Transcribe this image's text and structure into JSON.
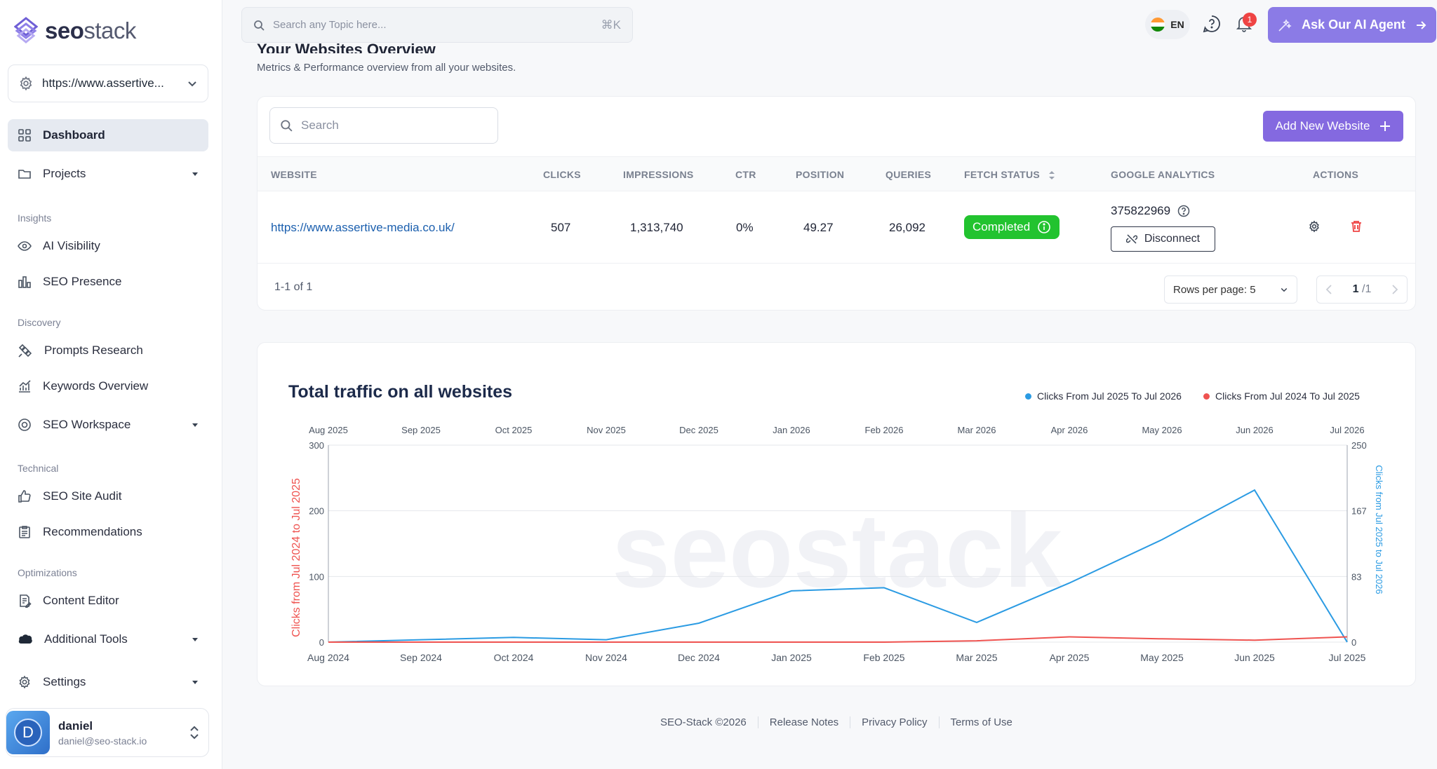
{
  "brand": {
    "name_bold": "seo",
    "name_light": "stack"
  },
  "site_selector": {
    "value": "https://www.assertive..."
  },
  "sidebar": {
    "dashboard": "Dashboard",
    "projects": "Projects",
    "section_insights": "Insights",
    "ai_visibility": "AI Visibility",
    "seo_presence": "SEO Presence",
    "section_discovery": "Discovery",
    "prompts_research": "Prompts Research",
    "keywords_overview": "Keywords Overview",
    "seo_workspace": "SEO Workspace",
    "section_technical": "Technical",
    "seo_site_audit": "SEO Site Audit",
    "recommendations": "Recommendations",
    "section_optimizations": "Optimizations",
    "content_editor": "Content Editor",
    "additional_tools": "Additional Tools",
    "settings": "Settings"
  },
  "user": {
    "initial": "D",
    "name": "daniel",
    "email": "daniel@seo-stack.io"
  },
  "topbar": {
    "search_placeholder": "Search any Topic here...",
    "shortcut": "⌘K",
    "language": "EN",
    "notifications_count": "1",
    "ai_button": "Ask Our AI Agent"
  },
  "overview": {
    "title": "Your Websites Overview",
    "subtitle": "Metrics & Performance overview from all your websites."
  },
  "table": {
    "search_placeholder": "Search",
    "add_button": "Add New Website",
    "headers": {
      "website": "WEBSITE",
      "clicks": "CLICKS",
      "impressions": "IMPRESSIONS",
      "ctr": "CTR",
      "position": "POSITION",
      "queries": "QUERIES",
      "fetch_status": "FETCH STATUS",
      "google_analytics": "GOOGLE ANALYTICS",
      "actions": "ACTIONS"
    },
    "row": {
      "website": "https://www.assertive-media.co.uk/",
      "clicks": "507",
      "impressions": "1,313,740",
      "ctr": "0%",
      "position": "49.27",
      "queries": "26,092",
      "status": "Completed",
      "ga_id": "375822969",
      "disconnect": "Disconnect"
    },
    "count_text": "1-1 of 1",
    "rows_per_page": "Rows per page: 5",
    "page_current": "1",
    "page_total": "/1"
  },
  "colors": {
    "current": "#2b9be3",
    "previous": "#ef5350",
    "accent": "#8469e0",
    "status": "#22c32f"
  },
  "chart_data": {
    "type": "line",
    "title": "Total traffic on all websites",
    "top_x_labels": [
      "Aug 2025",
      "Sep 2025",
      "Oct 2025",
      "Nov 2025",
      "Dec 2025",
      "Jan 2026",
      "Feb 2026",
      "Mar 2026",
      "Apr 2026",
      "May 2026",
      "Jun 2026",
      "Jul 2026"
    ],
    "bottom_x_labels": [
      "Aug 2024",
      "Sep 2024",
      "Oct 2024",
      "Nov 2024",
      "Dec 2024",
      "Jan 2025",
      "Feb 2025",
      "Mar 2025",
      "Apr 2025",
      "May 2025",
      "Jun 2025",
      "Jul 2025"
    ],
    "left_ylabel": "Clicks from Jul 2024 to Jul 2025",
    "right_ylabel": "Clicks from Jul 2025 to Jul 2026",
    "left_ylim": [
      0,
      300
    ],
    "left_ticks": [
      "300",
      "200",
      "100",
      "0"
    ],
    "right_ylim": [
      0,
      250
    ],
    "right_ticks": [
      "250",
      "167",
      "83",
      "0"
    ],
    "series": [
      {
        "name": "Clicks From Jul 2025 To Jul 2026",
        "axis": "right",
        "values": [
          0,
          3,
          6,
          3,
          24,
          65,
          69,
          25,
          75,
          130,
          193,
          0
        ]
      },
      {
        "name": "Clicks From Jul 2024 To Jul 2025",
        "axis": "left",
        "values": [
          0,
          0,
          0,
          0,
          0,
          0,
          0,
          2,
          8,
          5,
          3,
          8
        ]
      }
    ],
    "watermark": "seostack"
  },
  "footer": {
    "copyright": "SEO-Stack ©2026",
    "release_notes": "Release Notes",
    "privacy": "Privacy Policy",
    "terms": "Terms of Use"
  }
}
